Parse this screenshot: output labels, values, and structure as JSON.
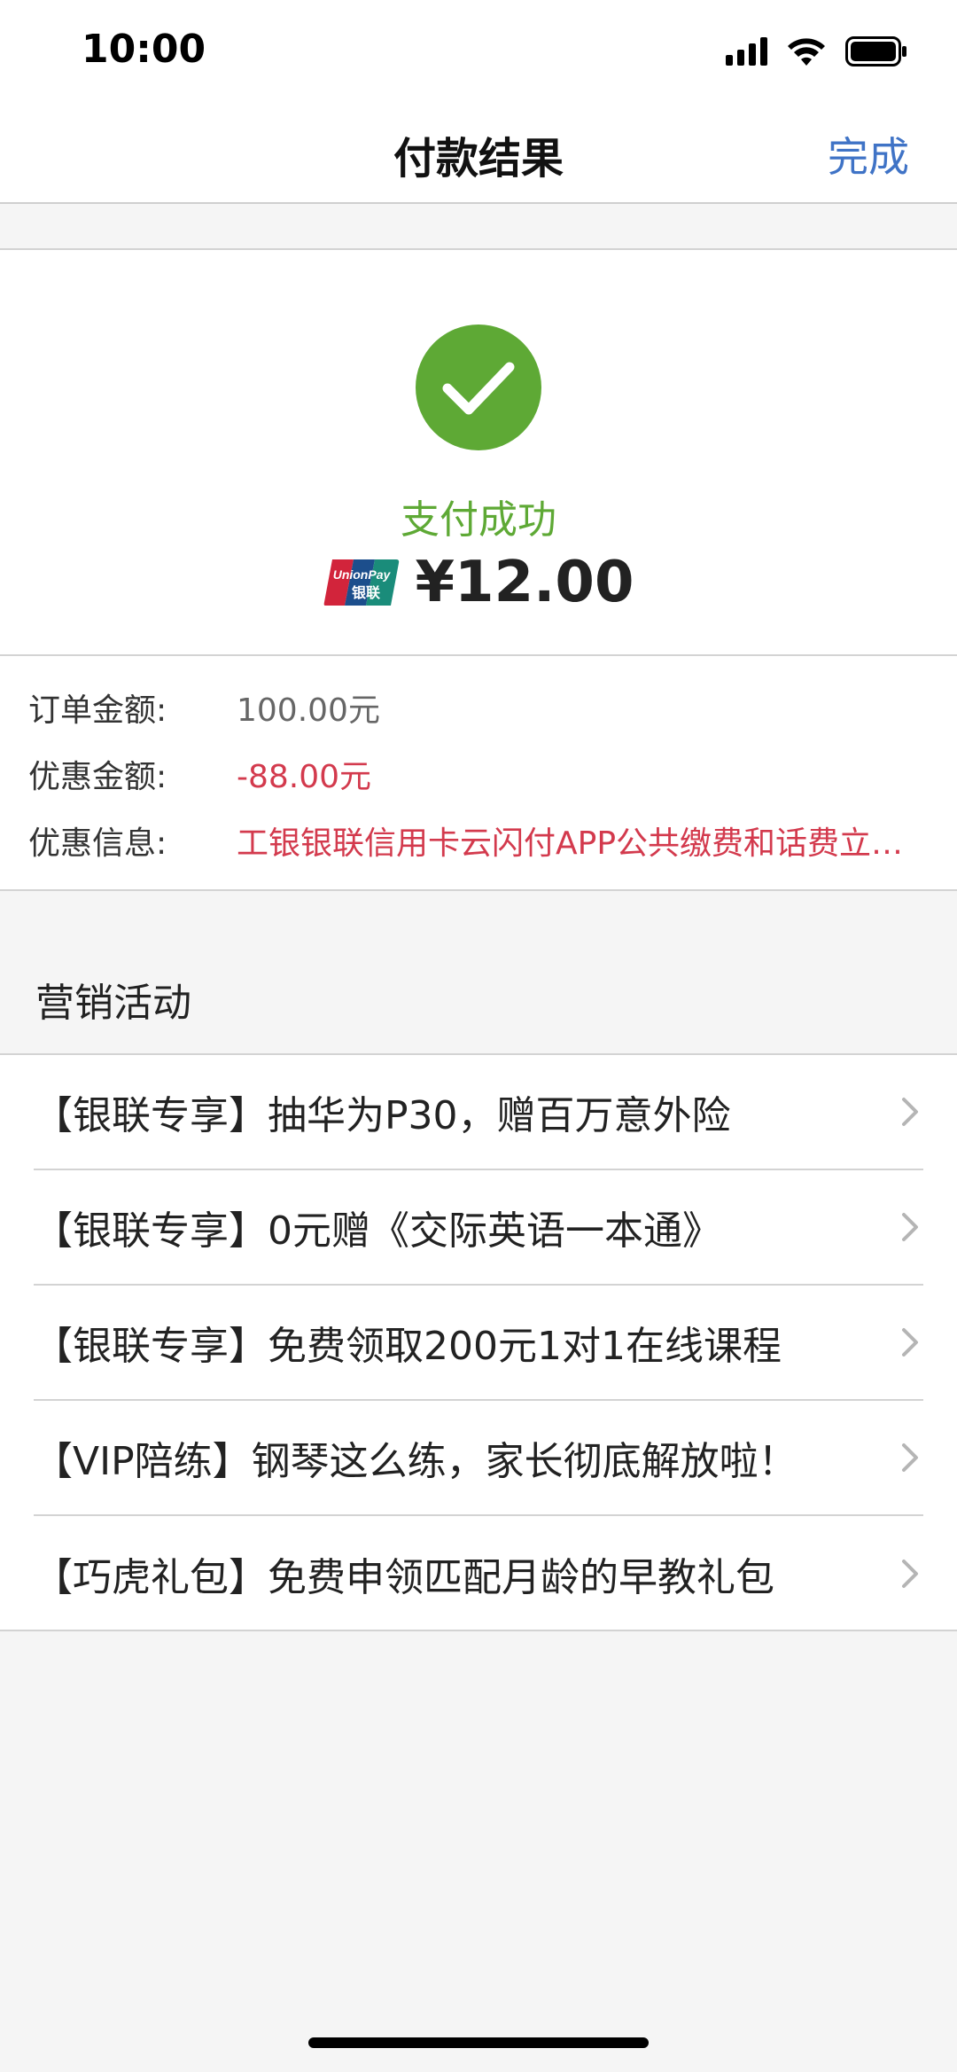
{
  "status_bar": {
    "time": "10:00",
    "icons": [
      "signal-icon",
      "wifi-icon",
      "battery-icon"
    ]
  },
  "nav": {
    "title": "付款结果",
    "done_label": "完成",
    "done_color": "#3f73c6"
  },
  "result": {
    "icon": "success-check-icon",
    "status": "支付成功",
    "status_color": "#5ea935",
    "logo_text": "UnionPay",
    "logo_text_cn": "银联",
    "amount": "¥12.00"
  },
  "details": [
    {
      "label": "订单金额:",
      "value": "100.00元"
    },
    {
      "label": "优惠金额:",
      "value": "-88.00元"
    },
    {
      "label": "优惠信息:",
      "value": "工银银联信用卡云闪付APP公共缴费和话费立…"
    }
  ],
  "marketing": {
    "title": "营销活动",
    "items": [
      {
        "label": "【银联专享】抽华为P30，赠百万意外险"
      },
      {
        "label": "【银联专享】0元赠《交际英语一本通》"
      },
      {
        "label": "【银联专享】免费领取200元1对1在线课程"
      },
      {
        "label": "【VIP陪练】钢琴这么练，家长彻底解放啦！"
      },
      {
        "label": "【巧虎礼包】免费申领匹配月龄的早教礼包"
      }
    ]
  },
  "colors": {
    "accent_red": "#d33a4d",
    "background": "#f5f5f5"
  }
}
